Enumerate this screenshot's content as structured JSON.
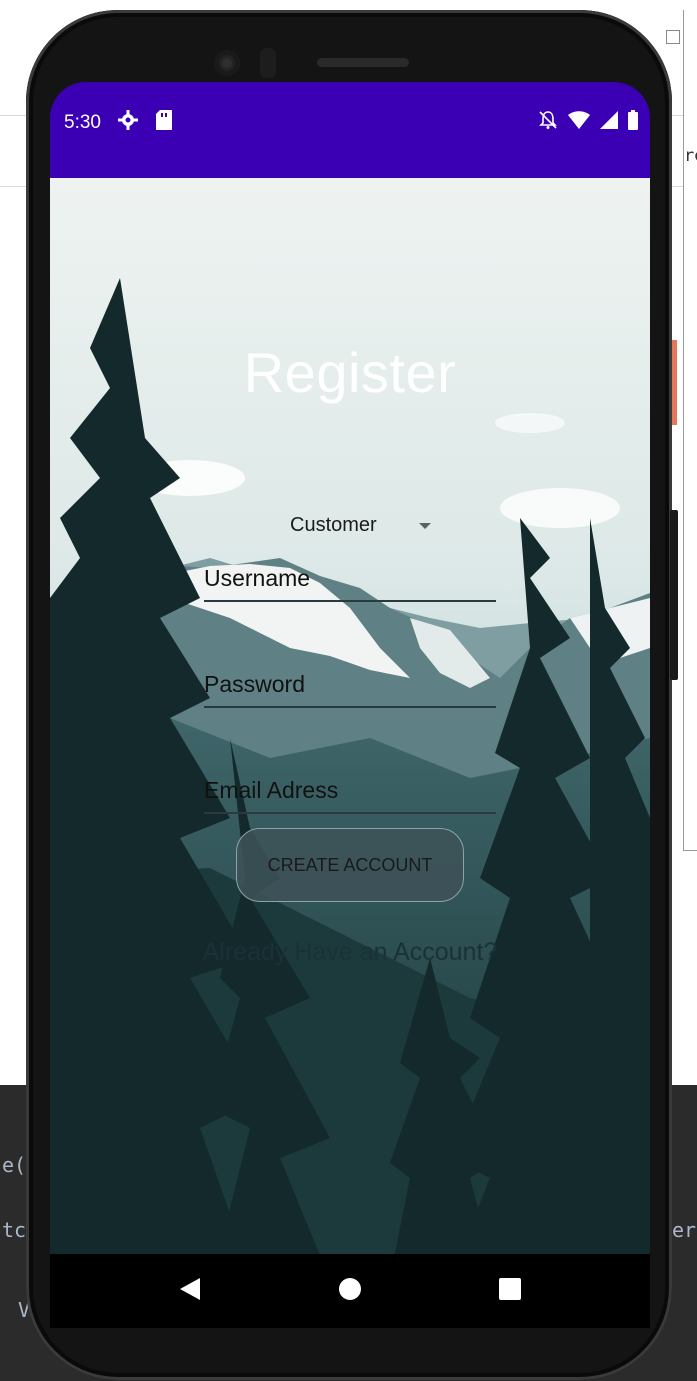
{
  "ide": {
    "left_fragment_1": "e(",
    "left_fragment_2": "tc",
    "left_fragment_3": "V",
    "right_fragment_1": "re",
    "right_fragment_2": "err"
  },
  "status_bar": {
    "time": "5:30",
    "icons_left": [
      "gear-icon",
      "sd-card-icon"
    ],
    "icons_right": [
      "silent-bell-icon",
      "wifi-icon",
      "signal-icon",
      "battery-icon"
    ],
    "color": "#3b00b4"
  },
  "register": {
    "title": "Register",
    "account_type": "Customer",
    "username_placeholder": "Username",
    "password_placeholder": "Password",
    "email_placeholder": "Email Adress",
    "create_button": "CREATE ACCOUNT",
    "login_link": "Already Have an Account?"
  },
  "nav": {
    "icons": [
      "back-triangle-icon",
      "home-circle-icon",
      "recents-square-icon"
    ]
  }
}
